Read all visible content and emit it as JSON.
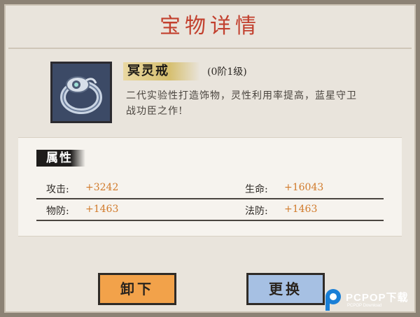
{
  "dialog": {
    "title": "宝物详情"
  },
  "item": {
    "icon": "ring-icon",
    "name": "冥灵戒",
    "grade": "(0阶1级)",
    "description": "二代实验性打造饰物，灵性利用率提高，蓝星守卫战功臣之作!"
  },
  "stats": {
    "header": "属性",
    "attack_label": "攻击:",
    "attack_value": "+3242",
    "hp_label": "生命:",
    "hp_value": "+16043",
    "pdef_label": "物防:",
    "pdef_value": "+1463",
    "mdef_label": "法防:",
    "mdef_value": "+1463"
  },
  "buttons": {
    "unload_label": "卸下",
    "replace_label": "更换"
  },
  "watermark": {
    "brand": "PCPOP下载",
    "sub": "PCPOP Download"
  },
  "colors": {
    "title": "#c2402e",
    "stat_value": "#d17a2a",
    "unload_button": "#f2a24a",
    "replace_button": "#a6c0e3"
  }
}
